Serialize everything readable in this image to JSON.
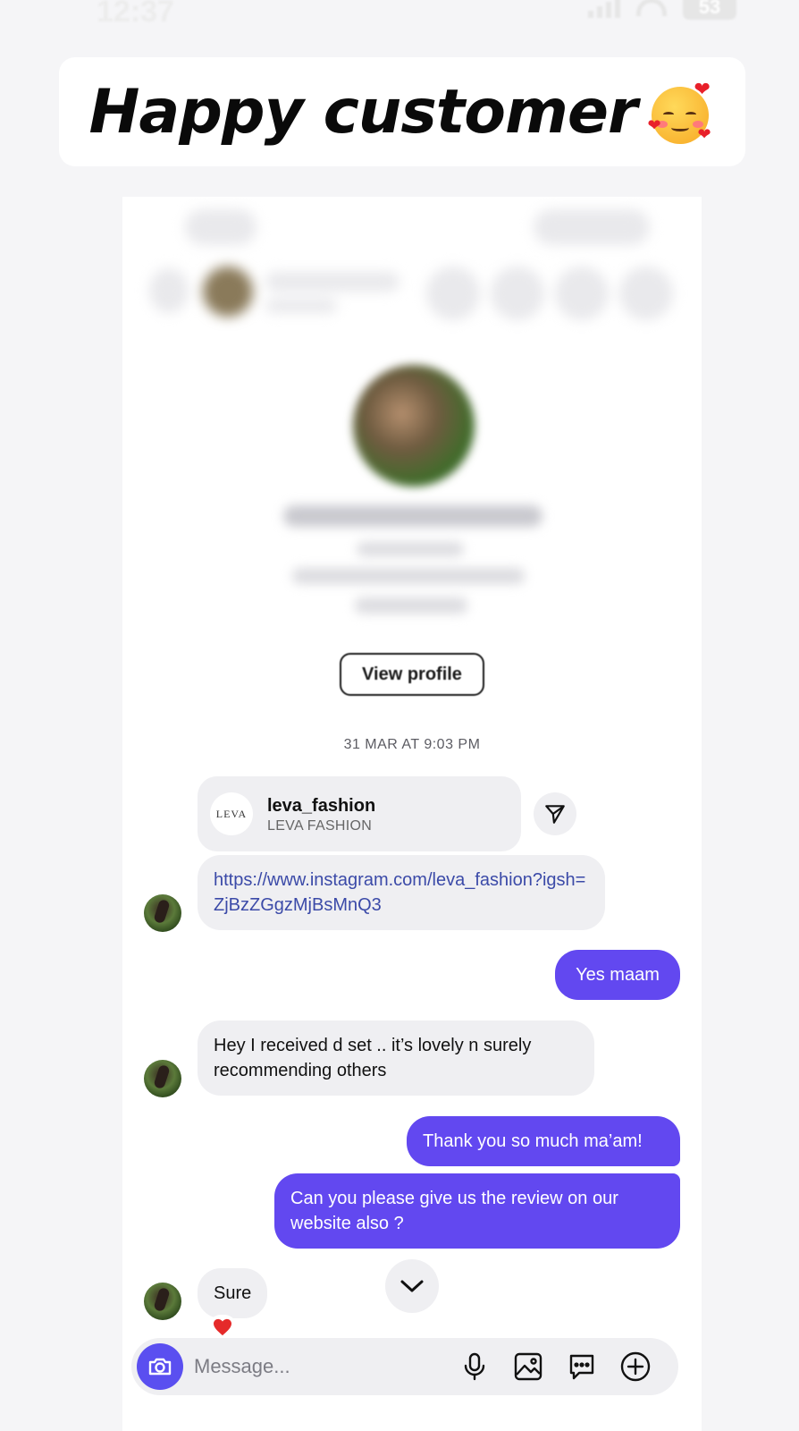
{
  "status_bar": {
    "time": "12:37",
    "battery": "53"
  },
  "headline": {
    "text": "Happy customer",
    "emoji_icon": "smiling-face-with-hearts-icon"
  },
  "profile": {
    "view_profile_label": "View profile"
  },
  "thread": {
    "date_stamp": "31 MAR AT 9:03 PM",
    "shared_account": {
      "logo_text": "LEVA",
      "username": "leva_fashion",
      "display_name": "LEVA FASHION"
    },
    "messages": [
      {
        "from": "them",
        "text": "https://www.instagram.com/leva_fashion?igsh=ZjBzZGgzMjBsMnQ3"
      },
      {
        "from": "me",
        "text": "Yes maam"
      },
      {
        "from": "them",
        "text": "Hey I received d set .. it’s lovely n surely recommending others"
      },
      {
        "from": "me",
        "text": "Thank you so much ma’am!"
      },
      {
        "from": "me",
        "text": "Can you please give us the review on our website also ?"
      },
      {
        "from": "them",
        "text": "Sure",
        "reaction": "heart"
      }
    ]
  },
  "composer": {
    "placeholder": "Message..."
  },
  "colors": {
    "outgoing_bubble": "#6248f0",
    "incoming_bubble": "#efeff2",
    "link": "#3b4aa8",
    "camera_button": "#5a4ff0"
  }
}
